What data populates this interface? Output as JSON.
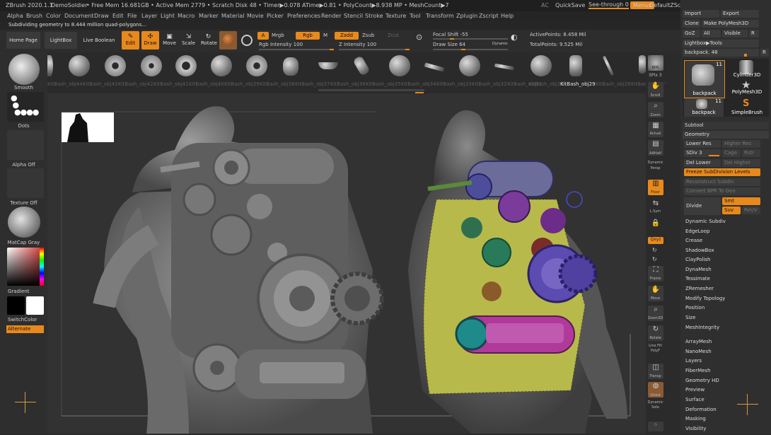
{
  "titlebar": {
    "app": "ZBrush 2020.1.1",
    "project": "DemoSoldier",
    "stats": "• Free Mem 16.681GB • Active Mem 2779 • Scratch Disk 48 • Timer▶0.078 ATime▶0.81 • PolyCount▶8.938 MP • MeshCount▶7",
    "ac": "AC",
    "quicksave": "QuickSave",
    "seethrough": "See-through 0",
    "menus": "Menus",
    "script": "DefaultZScript"
  },
  "menu": [
    "Alpha",
    "Brush",
    "Color",
    "Document",
    "Draw",
    "Edit",
    "File",
    "Layer",
    "Light",
    "Macro",
    "Marker",
    "Material",
    "Movie",
    "Picker",
    "Preferences",
    "Render",
    "Stencil",
    "Stroke",
    "Texture",
    "Tool",
    "Transform",
    "Zplugin",
    "Zscript",
    "Help"
  ],
  "status": "Subdividing geometry to 8.444 million quad-polygons...",
  "toolbar": {
    "homepage": "Home Page",
    "lightbox": "LightBox",
    "liveboolean": "Live Boolean",
    "edit": "Edit",
    "draw": "Draw",
    "move": "Move",
    "scale": "Scale",
    "rotate": "Rotate",
    "a": "A",
    "mrgb": "Mrgb",
    "rgb": "Rgb",
    "m": "M",
    "zadd": "Zadd",
    "zsub": "Zsub",
    "zcut": "Zcut",
    "rgb_intensity": "Rgb Intensity 100",
    "z_intensity": "Z Intensity 100",
    "focal_shift": "Focal Shift -55",
    "draw_size": "Draw Size 64",
    "dynamic": "Dynamic",
    "active_points": "ActivePoints: 8.458 Mil",
    "total_points": "TotalPoints: 9.525 Mil"
  },
  "kitbash": {
    "selected": "KitBash_obj29",
    "labels": [
      "KitBash_obj44",
      "KitBash_obj43",
      "KitBash_obj42",
      "KitBash_obj41",
      "KitBash_obj40",
      "KitBash_obj39",
      "KitBash_obj38",
      "KitBash_obj37",
      "KitBash_obj36",
      "KitBash_obj35",
      "KitBash_obj34",
      "KitBash_obj33",
      "KitBash_obj32",
      "KitBash_obj31",
      "KitBash_obj30",
      "KitBash_obj29",
      "KitBash_obj28",
      "KitBash_obj27"
    ]
  },
  "leftpanel": {
    "brush": "Smooth",
    "stroke": "Dots",
    "alpha": "Alpha Off",
    "texture": "Texture Off",
    "material": "MatCap Gray",
    "gradient": "Gradient",
    "switchcolor": "SwitchColor",
    "alternate": "Alternate"
  },
  "iconcol": [
    "BPR",
    "SPix 3",
    "Scroll",
    "Zoom",
    "Actual",
    "AAHalf",
    "Dynamic Persp",
    "Floor",
    "L.Sym",
    "Lock",
    "Qxyz",
    "Frame",
    "Move",
    "Zoom3D",
    "Rotate",
    "Line Fill PolyF",
    "Transp",
    "Ghost",
    "Dynamic Solo"
  ],
  "rightpanel": {
    "import": "Import",
    "export": "Export",
    "clone": "Clone",
    "makepolymesh": "Make PolyMesh3D",
    "goz": "GoZ",
    "all": "All",
    "visible": "Visible",
    "r": "R",
    "lightbox_tools": "Lightbox▶Tools",
    "backpack_slider": "backpack. 48",
    "tools": [
      {
        "name": "backpack",
        "count": "11"
      },
      {
        "name": "Cylinder3D",
        "count": ""
      },
      {
        "name": "PolyMesh3D",
        "count": ""
      },
      {
        "name": "backpack",
        "count": "11"
      },
      {
        "name": "SimpleBrush",
        "count": ""
      }
    ],
    "subtool": "Subtool",
    "geometry": "Geometry",
    "lower_res": "Lower Res",
    "higher_res": "Higher Res",
    "sdiv": "SDiv 3",
    "cage": "Cage",
    "rstr": "Rstr",
    "del_lower": "Del Lower",
    "del_higher": "Del Higher",
    "freeze": "Freeze SubDivision Levels",
    "reconstruct": "Reconstruct Subdiv",
    "convert_bpr": "Convert BPR To Geo",
    "divide": "Divide",
    "smt": "Smt",
    "suv": "Suv",
    "reuv": "ReUV",
    "items": [
      "Dynamic Subdiv",
      "EdgeLoop",
      "Crease",
      "ShadowBox",
      "ClayPolish",
      "DynaMesh",
      "Tessimate",
      "ZRemesher",
      "Modify Topology",
      "Position",
      "Size",
      "MeshIntegrity"
    ],
    "sections": [
      "ArrayMesh",
      "NanoMesh",
      "Layers",
      "FiberMesh",
      "Geometry HD",
      "Preview",
      "Surface",
      "Deformation",
      "Masking",
      "Visibility"
    ]
  },
  "colors": {
    "accent": "#e8891c",
    "panel": "#2f2f2f",
    "viewport": "#323232"
  }
}
